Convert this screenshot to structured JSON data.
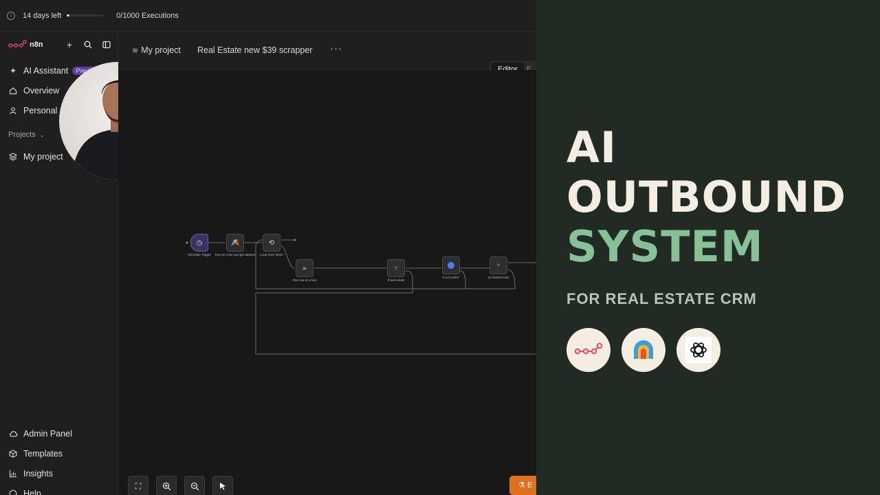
{
  "topbar": {
    "trial_text": "14 days left",
    "executions": "0/1000 Executions"
  },
  "sidebar": {
    "brand": "n8n",
    "items": [
      {
        "label": "AI Assistant",
        "badge": "Preview",
        "icon": "sparkle-icon"
      },
      {
        "label": "Overview",
        "icon": "home-icon"
      },
      {
        "label": "Personal",
        "icon": "user-icon"
      }
    ],
    "projects_label": "Projects",
    "project_item": "My project",
    "bottom_items": [
      {
        "label": "Admin Panel",
        "icon": "cloud-icon"
      },
      {
        "label": "Templates",
        "icon": "box-icon"
      },
      {
        "label": "Insights",
        "icon": "chart-icon"
      },
      {
        "label": "Help",
        "icon": "help-icon"
      }
    ]
  },
  "header": {
    "project": "My project",
    "workflow_name": "Real Estate new $39 scrapper",
    "more": "···",
    "tab_editor": "Editor",
    "tab_executions": "E"
  },
  "workflow": {
    "nodes": [
      {
        "label": "Schedule Trigger",
        "icon": "clock-icon"
      },
      {
        "label": "Run an Actor and get dataset",
        "icon": "apify-icon"
      },
      {
        "label": "Loop Over Items",
        "icon": "loop-icon"
      },
      {
        "label": "One row at a time",
        "icon": "forward-icon"
      },
      {
        "label": "If real estate",
        "icon": "branch-icon"
      },
      {
        "label": "If url exists?",
        "icon": "openai-icon"
      },
      {
        "label": "url doesn't exist",
        "icon": "branch-icon"
      }
    ]
  },
  "bottom_button": "E",
  "panel": {
    "line1": "AI",
    "line2": "OUTBOUND",
    "line3": "SYSTEM",
    "subtitle": "FOR REAL ESTATE CRM",
    "logos": [
      "n8n-logo",
      "apify-logo",
      "openai-logo"
    ],
    "colors": {
      "background": "#212b24",
      "cream": "#f3ede2",
      "green": "#86c296"
    }
  }
}
